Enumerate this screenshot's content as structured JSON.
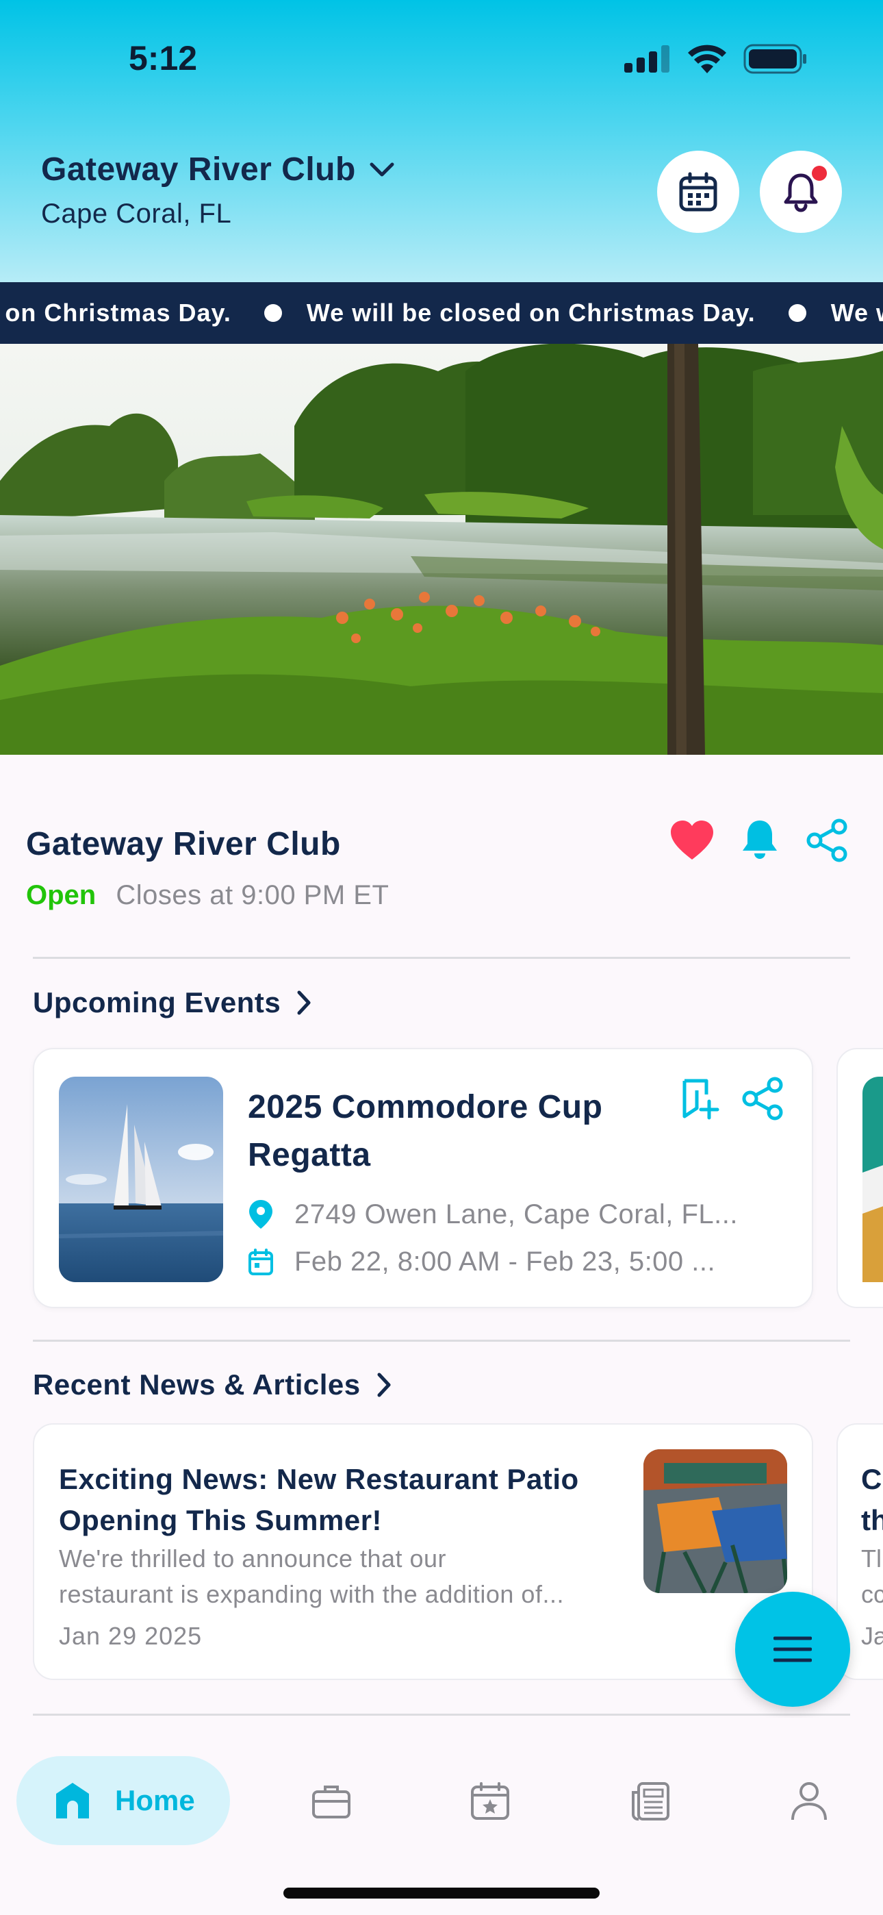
{
  "status_bar": {
    "time": "5:12"
  },
  "header": {
    "club_name": "Gateway River Club",
    "location": "Cape Coral, FL"
  },
  "ticker": {
    "message": "We will be closed on Christmas Day.",
    "visible_fragments": [
      "on Christmas Day.",
      "We will be closed on Christmas Day.",
      "We will"
    ]
  },
  "club_info": {
    "name": "Gateway River Club",
    "status": "Open",
    "hours": "Closes at 9:00 PM ET"
  },
  "upcoming_events": {
    "title": "Upcoming Events",
    "events": [
      {
        "title": "2025 Commodore Cup Regatta",
        "address": "2749 Owen Lane, Cape Coral, FL...",
        "date": "Feb 22, 8:00 AM - Feb 23, 5:00 ..."
      }
    ]
  },
  "news": {
    "title": "Recent News & Articles",
    "articles": [
      {
        "title": "Exciting News: New Restaurant Patio Opening This Summer!",
        "excerpt_line1": "We're thrilled to announce that our",
        "excerpt_line2": "restaurant is expanding with the addition of...",
        "date": "Jan 29 2025"
      }
    ],
    "peek": {
      "line1": "C",
      "line2": "th",
      "line3": "Tl",
      "line4": "cc",
      "line5": "Ja"
    }
  },
  "bottom_nav": {
    "items": [
      {
        "label": "Home",
        "icon": "home-icon",
        "active": true
      },
      {
        "label": "",
        "icon": "briefcase-icon"
      },
      {
        "label": "",
        "icon": "calendar-star-icon"
      },
      {
        "label": "",
        "icon": "newspaper-icon"
      },
      {
        "label": "",
        "icon": "person-icon"
      }
    ]
  },
  "colors": {
    "accent": "#00c3e6",
    "navy": "#13284b",
    "open_green": "#22c40a",
    "heart_red": "#ff3b5c",
    "notification_dot": "#ee2c3c"
  }
}
